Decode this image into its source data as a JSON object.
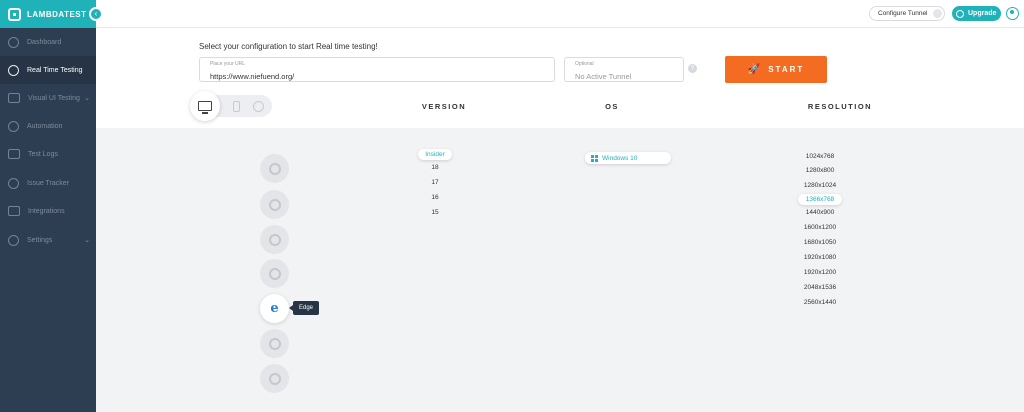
{
  "brand": {
    "name": "LAMBDATEST"
  },
  "sidebar": {
    "items": [
      {
        "label": "Dashboard"
      },
      {
        "label": "Real Time Testing"
      },
      {
        "label": "Visual UI Testing"
      },
      {
        "label": "Automation"
      },
      {
        "label": "Test Logs"
      },
      {
        "label": "Issue Tracker"
      },
      {
        "label": "Integrations"
      },
      {
        "label": "Settings"
      }
    ]
  },
  "topbar": {
    "tunnel_label": "Configure Tunnel",
    "upgrade_label": "Upgrade"
  },
  "config": {
    "title": "Select your configuration to start Real time testing!",
    "url_label": "Place your URL",
    "url_value": "https://www.niefuend.org/",
    "tunnel_label": "Optional",
    "tunnel_value": "No Active Tunnel",
    "help_glyph": "?",
    "start_label": "START",
    "start_icon_glyph": "🚀"
  },
  "columns": {
    "version": "VERSION",
    "os": "OS",
    "resolution": "RESOLUTION"
  },
  "browsers": {
    "icons": [
      "chrome-icon",
      "firefox-icon",
      "opera-icon",
      "ie-icon",
      "edge-icon",
      "safari-icon",
      "yandex-icon"
    ],
    "selected_glyph": "e",
    "tooltip": "Edge"
  },
  "versions": {
    "selected": "Insider",
    "items": [
      "18",
      "17",
      "16",
      "15"
    ]
  },
  "os": {
    "selected": "Windows 10"
  },
  "resolutions": {
    "items": [
      "1024x768",
      "1280x800",
      "1280x1024",
      "1366x768",
      "1440x900",
      "1600x1200",
      "1680x1050",
      "1920x1080",
      "1920x1200",
      "2048x1536",
      "2560x1440"
    ],
    "selected": "1366x768"
  },
  "colors": {
    "accent": "#1fb2b9",
    "start": "#f36c22",
    "sidebar": "#2e3e52"
  }
}
